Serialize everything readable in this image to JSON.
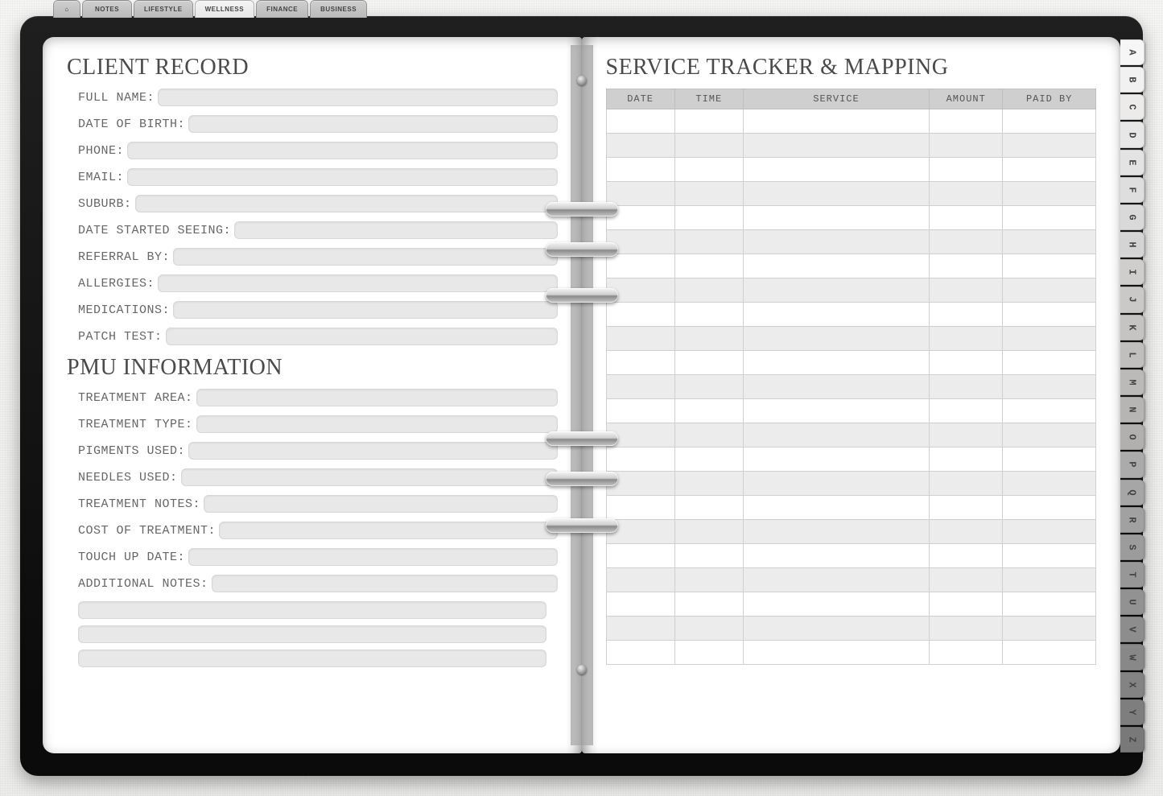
{
  "top_tabs": {
    "home_label": "⌂",
    "items": [
      "NOTES",
      "LIFESTYLE",
      "WELLNESS",
      "FINANCE",
      "BUSINESS"
    ],
    "active_index": 2
  },
  "left_page": {
    "title1": "CLIENT RECORD",
    "fields1": [
      {
        "id": "full-name",
        "label": "FULL NAME:"
      },
      {
        "id": "dob",
        "label": "DATE OF BIRTH:"
      },
      {
        "id": "phone",
        "label": "PHONE:"
      },
      {
        "id": "email",
        "label": "EMAIL:"
      },
      {
        "id": "suburb",
        "label": "SUBURB:"
      },
      {
        "id": "date-started",
        "label": "DATE STARTED SEEING:"
      },
      {
        "id": "referral",
        "label": "REFERRAL BY:"
      },
      {
        "id": "allergies",
        "label": "ALLERGIES:"
      },
      {
        "id": "medications",
        "label": "MEDICATIONS:"
      },
      {
        "id": "patch-test",
        "label": "PATCH TEST:"
      }
    ],
    "title2": "PMU INFORMATION",
    "fields2": [
      {
        "id": "treatment-area",
        "label": "TREATMENT AREA:"
      },
      {
        "id": "treatment-type",
        "label": "TREATMENT TYPE:"
      },
      {
        "id": "pigments-used",
        "label": "PIGMENTS USED:"
      },
      {
        "id": "needles-used",
        "label": "NEEDLES USED:"
      },
      {
        "id": "treatment-notes",
        "label": "TREATMENT NOTES:"
      },
      {
        "id": "cost",
        "label": "COST OF TREATMENT:"
      },
      {
        "id": "touch-up",
        "label": "TOUCH UP DATE:"
      },
      {
        "id": "additional-notes",
        "label": "ADDITIONAL NOTES:"
      }
    ],
    "extra_blank_rows": 3
  },
  "right_page": {
    "title": "SERVICE TRACKER & MAPPING",
    "columns": [
      {
        "id": "date",
        "label": "DATE",
        "width": "14%"
      },
      {
        "id": "time",
        "label": "TIME",
        "width": "14%"
      },
      {
        "id": "service",
        "label": "SERVICE",
        "width": "38%"
      },
      {
        "id": "amount",
        "label": "AMOUNT",
        "width": "15%"
      },
      {
        "id": "paid-by",
        "label": "PAID BY",
        "width": "19%"
      }
    ],
    "row_count": 23
  },
  "alpha_tabs": [
    "A",
    "B",
    "C",
    "D",
    "E",
    "F",
    "G",
    "H",
    "I",
    "J",
    "K",
    "L",
    "M",
    "N",
    "O",
    "P",
    "Q",
    "R",
    "S",
    "T",
    "U",
    "V",
    "W",
    "X",
    "Y",
    "Z"
  ],
  "alpha_shades": [
    "#f6f6f6",
    "#f1f1f1",
    "#ecebea",
    "#e7e7e7",
    "#e3e3e3",
    "#dedede",
    "#d9d9d9",
    "#d4d4d4",
    "#cfcecd",
    "#cac9c8",
    "#c5c4c3",
    "#c0bfbe",
    "#bbbab9",
    "#b6b5b4",
    "#b1b0af",
    "#acabab",
    "#a7a6a6",
    "#a2a1a1",
    "#9d9c9c",
    "#989797",
    "#939292",
    "#8e8d8d",
    "#898888",
    "#848383",
    "#7f7e7e",
    "#7a7979"
  ]
}
